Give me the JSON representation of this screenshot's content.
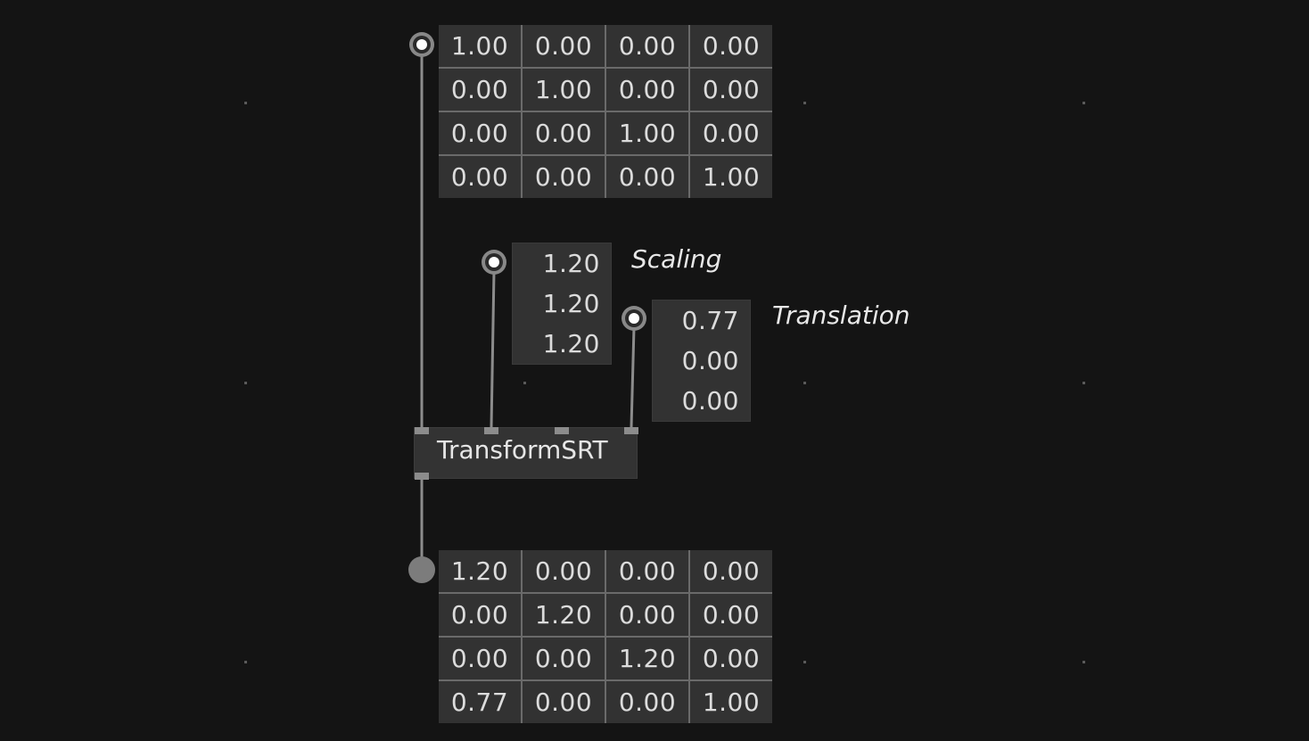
{
  "input_matrix": [
    [
      "1.00",
      "0.00",
      "0.00",
      "0.00"
    ],
    [
      "0.00",
      "1.00",
      "0.00",
      "0.00"
    ],
    [
      "0.00",
      "0.00",
      "1.00",
      "0.00"
    ],
    [
      "0.00",
      "0.00",
      "0.00",
      "1.00"
    ]
  ],
  "scaling": {
    "label": "Scaling",
    "values": [
      "1.20",
      "1.20",
      "1.20"
    ]
  },
  "translation": {
    "label": "Translation",
    "values": [
      "0.77",
      "0.00",
      "0.00"
    ]
  },
  "node": {
    "title": "TransformSRT"
  },
  "output_matrix": [
    [
      "1.20",
      "0.00",
      "0.00",
      "0.00"
    ],
    [
      "0.00",
      "1.20",
      "0.00",
      "0.00"
    ],
    [
      "0.00",
      "0.00",
      "1.20",
      "0.00"
    ],
    [
      "0.77",
      "0.00",
      "0.00",
      "1.00"
    ]
  ],
  "colors": {
    "background": "#141414",
    "box": "#323232",
    "wire": "#8c8c8c",
    "text": "#dcdcdc"
  }
}
